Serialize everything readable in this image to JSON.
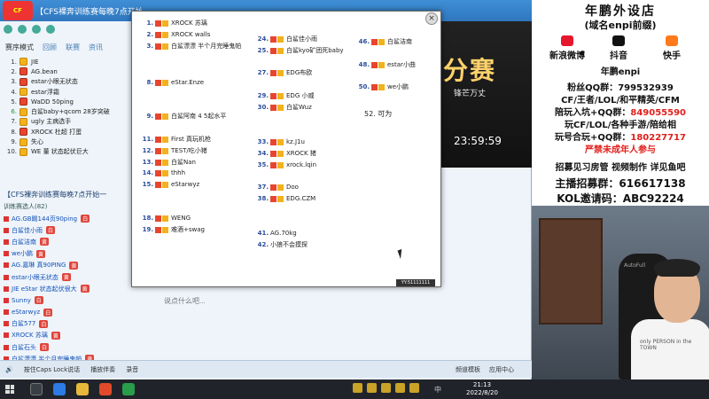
{
  "client": {
    "title": "【CFS裸奔训练赛每晚7点开始",
    "logo": "CF",
    "mode_label": "赛序模式",
    "tabs": [
      "回顾",
      "联赛",
      "资讯"
    ]
  },
  "rank_list": [
    {
      "num": "1.",
      "name": "JIE"
    },
    {
      "num": "2.",
      "name": "AG.bean"
    },
    {
      "num": "3.",
      "name": "estar小眼无状态"
    },
    {
      "num": "4.",
      "name": "estar浮霜"
    },
    {
      "num": "5.",
      "name": "WaDD 50ping"
    },
    {
      "num": "6.",
      "name": "白鲨baby+qcom 28岁突破"
    },
    {
      "num": "7.",
      "name": "ugly 主病选手"
    },
    {
      "num": "8.",
      "name": "XROCK 杜超 打蛋"
    },
    {
      "num": "9.",
      "name": "失心"
    },
    {
      "num": "10.",
      "name": "WE 董 状态起伏巨大"
    }
  ],
  "room": {
    "header": "【CFS裸奔训练赛每晚7点开始一",
    "sub": "训练赛选人(82)",
    "members": [
      {
        "name": "AG.GB踢144页90ping",
        "tag": "白"
      },
      {
        "name": "白鲨佳小雨",
        "tag": "白"
      },
      {
        "name": "白鲨洁南",
        "tag": "黄"
      },
      {
        "name": "we小鹏",
        "tag": "黄"
      },
      {
        "name": "AG.嘉琳 真90PING",
        "tag": "黄"
      },
      {
        "name": "estar小眼无状态",
        "tag": "黄"
      },
      {
        "name": "JIE eStar 状态起伏很大",
        "tag": "黄"
      },
      {
        "name": "Sunny",
        "tag": "白"
      },
      {
        "name": "eStarwyz",
        "tag": "白"
      },
      {
        "name": "白鲨577",
        "tag": "白"
      },
      {
        "name": "XROCK 苏璃",
        "tag": "黄"
      },
      {
        "name": "白鲨石头",
        "tag": "白"
      },
      {
        "name": "白鲨漂漂 半个月完睡鬼帕",
        "tag": "黄"
      }
    ]
  },
  "chat_placeholder": "说点什么吧...",
  "bottom_bar": {
    "items": [
      "按住Caps Lock说话",
      "播放伴奏",
      "录音"
    ],
    "right": [
      "频道模板",
      "应用中心"
    ]
  },
  "stream_overlay": {
    "text": "分赛",
    "sub": "锋芒万丈",
    "time": "23:59:59"
  },
  "popup": {
    "note": "52. 可为",
    "footer": "YY:51111111",
    "col1": [
      {
        "n": "1.",
        "t": "XROCK 苏璃"
      },
      {
        "n": "2.",
        "t": "XROCK walls"
      },
      {
        "n": "3.",
        "t": "白鲨漂漂 半个月完睡鬼帕"
      },
      {
        "n": "8.",
        "t": "eStar.Enze"
      },
      {
        "n": "9.",
        "t": "白鲨阿南 4 5起水平"
      },
      {
        "n": "11.",
        "t": "First 真玩机枪"
      },
      {
        "n": "12.",
        "t": "TEST/吃小猪"
      },
      {
        "n": "13.",
        "t": "白鲨Nan"
      },
      {
        "n": "14.",
        "t": "thhh"
      },
      {
        "n": "15.",
        "t": "eStarwyz"
      },
      {
        "n": "18.",
        "t": "WENG"
      },
      {
        "n": "19.",
        "t": "难酒+swag"
      }
    ],
    "col2": [
      {
        "n": "24.",
        "t": "白鲨佳小雨"
      },
      {
        "n": "25.",
        "t": "白鲨kyo矿团死baby"
      },
      {
        "n": "27.",
        "t": "EDG布欧"
      },
      {
        "n": "29.",
        "t": "EDG 小威"
      },
      {
        "n": "30.",
        "t": "白鲨Wuz"
      },
      {
        "n": "33.",
        "t": "kz.J1u"
      },
      {
        "n": "34.",
        "t": "XROCK 猪"
      },
      {
        "n": "35.",
        "t": "xrock.lqin"
      },
      {
        "n": "37.",
        "t": "Doo"
      },
      {
        "n": "38.",
        "t": "EDG.CZM"
      },
      {
        "n": "41.",
        "t": "AG.70kg"
      },
      {
        "n": "42.",
        "t": "小狼不会摸探"
      }
    ],
    "col3": [
      {
        "n": "46.",
        "t": "白鲨洁南"
      },
      {
        "n": "48.",
        "t": "estar小曲"
      },
      {
        "n": "50.",
        "t": "we小鹏"
      }
    ]
  },
  "panel": {
    "title": "年鹏外设店",
    "subtitle": "(域名enpi前缀)",
    "socials": [
      "新浪微博",
      "抖音",
      "快手"
    ],
    "author": "年鹏enpi",
    "lines": [
      {
        "a": "粉丝QQ群：",
        "b": "799532939"
      },
      {
        "a": "CF/王者/LOL/和平精英/CFM",
        "b": ""
      },
      {
        "a": "陪玩入坑+QQ群：",
        "b": "849055590"
      },
      {
        "a": "玩CF/LOL/各种手游/陪给相",
        "b": ""
      },
      {
        "a": "玩号合玩+QQ群：",
        "b": "180227717"
      },
      {
        "a": "严禁未成年人参与",
        "b": ""
      },
      {
        "a": "招募见习房管 视频制作 详见鱼吧",
        "b": ""
      },
      {
        "a": "主播招募群：",
        "b": "616617138"
      },
      {
        "a": "KOL邀请码：",
        "b": "ABC92224"
      }
    ]
  },
  "cam": {
    "chair_brand": "AutoFull",
    "shirt_text": "only PERSON in the TOWN"
  },
  "taskbar": {
    "time": "21:13",
    "date": "2022/8/20",
    "ime": "中"
  },
  "colors": {
    "titlebar": "#2f77bf",
    "accent_red": "#e0201c",
    "badge_gold": "#f2b21d"
  }
}
